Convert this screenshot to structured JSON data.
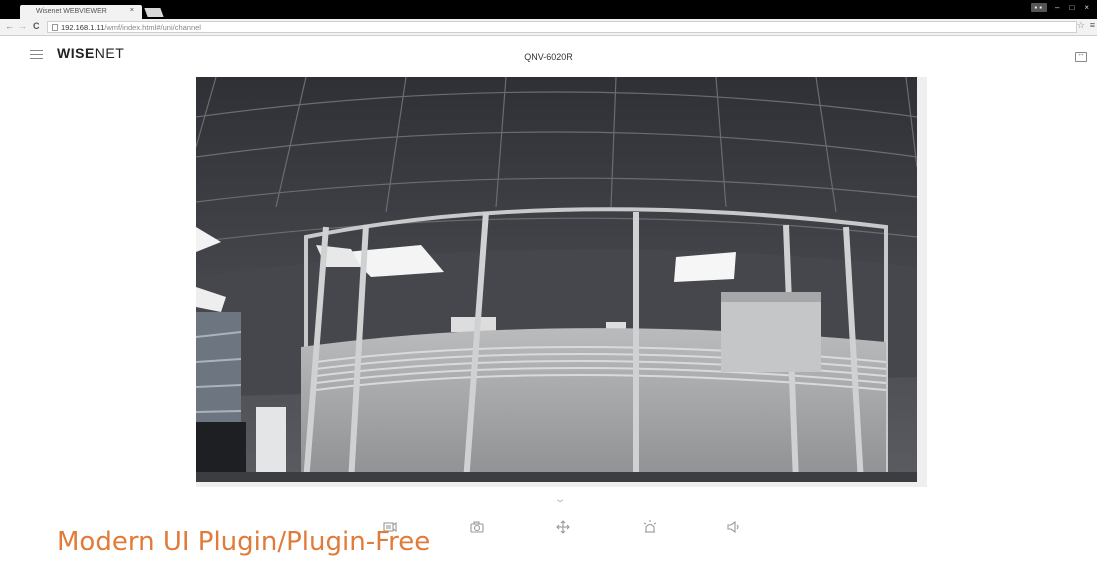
{
  "browser": {
    "tab_title": "Wisenet WEBVIEWER",
    "tab_close": "×",
    "url_host": "192.168.1.11",
    "url_path": "/wmf/index.html#/uni/channel",
    "nav_back": "←",
    "nav_forward": "→",
    "nav_reload": "C",
    "star": "☆",
    "menu": "≡",
    "window_controls": {
      "minimize": "–",
      "restore": "□",
      "close": "×"
    }
  },
  "app": {
    "logo_bold": "WISE",
    "logo_light": "NET",
    "model": "QNV-6020R"
  },
  "toolbar": {
    "collapse": "⌄",
    "tools": [
      "record-icon",
      "snapshot-icon",
      "ptz-icon",
      "alarm-icon",
      "audio-icon"
    ]
  },
  "caption": "Modern UI Plugin/Plugin-Free",
  "colors": {
    "caption": "#E07B39"
  }
}
